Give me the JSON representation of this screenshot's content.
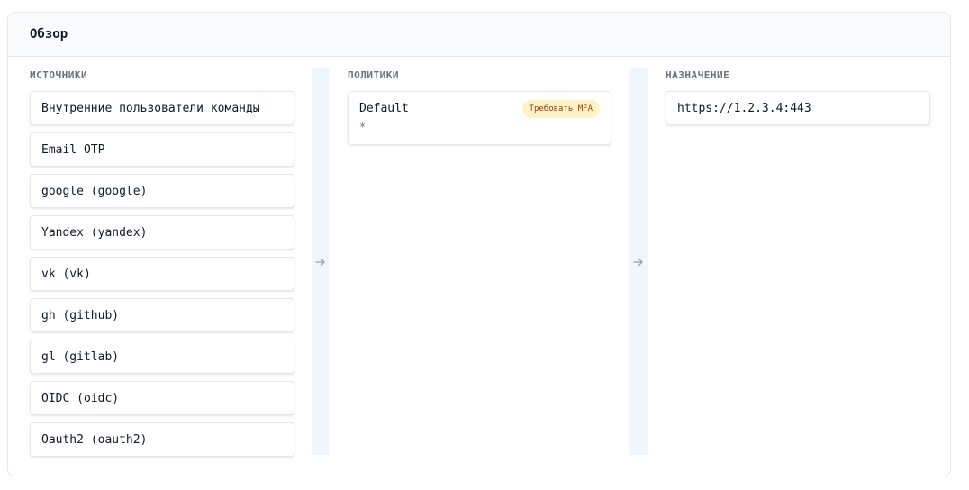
{
  "header": {
    "title": "Обзор"
  },
  "sources": {
    "label": "ИСТОЧНИКИ",
    "items": [
      "Внутренние пользователи команды",
      "Email OTP",
      "google (google)",
      "Yandex (yandex)",
      "vk (vk)",
      "gh (github)",
      "gl (gitlab)",
      "OIDC (oidc)",
      "Oauth2 (oauth2)"
    ]
  },
  "policies": {
    "label": "ПОЛИТИКИ",
    "items": [
      {
        "name": "Default",
        "pattern": "*",
        "badge": "Требовать MFA"
      }
    ]
  },
  "destination": {
    "label": "НАЗНАЧЕНИЕ",
    "items": [
      "https://1.2.3.4:443"
    ]
  },
  "colors": {
    "connector_bg": "#eff6ff",
    "badge_bg": "#fef3c7",
    "badge_text": "#92400e"
  },
  "icons": {
    "connector": "arrow-right-icon"
  }
}
